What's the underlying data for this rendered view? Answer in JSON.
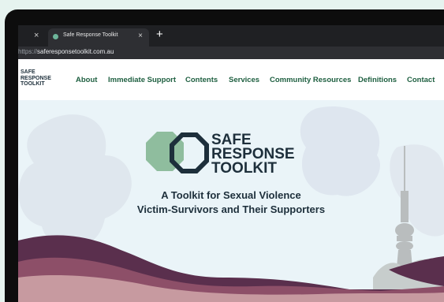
{
  "browser": {
    "prev_tab_close": "×",
    "tab_title": "Safe Response Toolkit",
    "tab_close": "×",
    "new_tab": "+",
    "url_protocol": "https://",
    "url_host": "saferesponsetoolkit.com.au"
  },
  "site": {
    "logo_line1": "SAFE",
    "logo_line2": "RESPONSE",
    "logo_line3": "TOOLKIT",
    "nav": [
      "About",
      "Immediate Support",
      "Contents",
      "Services",
      "Community Resources",
      "Definitions",
      "Contact"
    ]
  },
  "hero": {
    "logo_line1": "SAFE",
    "logo_line2": "RESPONSE",
    "logo_line3": "TOOLKIT",
    "tagline_line1": "A Toolkit for Sexual Violence",
    "tagline_line2": "Victim-Survivors and Their Supporters"
  },
  "colors": {
    "brand_green": "#1e5f40",
    "brand_navy": "#1d2f3b",
    "hills_plum": "#5a2f4d",
    "hills_rose": "#c79aa0"
  }
}
